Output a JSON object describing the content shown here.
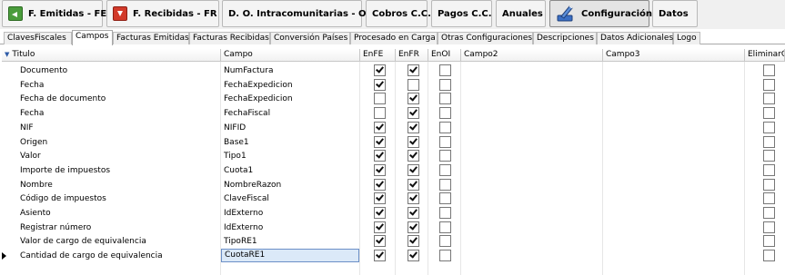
{
  "toolbar": {
    "buttons": [
      {
        "label": "F. Emitidas - FE",
        "icon": "invoice-issued-icon"
      },
      {
        "label": "F. Recibidas - FR",
        "icon": "invoice-received-icon"
      },
      {
        "label": "D. O. Intracomunitarias - OI"
      },
      {
        "label": "Cobros C.C."
      },
      {
        "label": "Pagos C.C."
      },
      {
        "label": "Anuales"
      },
      {
        "label": "Configuración",
        "icon": "configuration-icon",
        "active": true
      },
      {
        "label": "Datos"
      }
    ]
  },
  "tabs": [
    {
      "label": "ClavesFiscales"
    },
    {
      "label": "Campos",
      "active": true
    },
    {
      "label": "Facturas Emitidas"
    },
    {
      "label": "Facturas Recibidas"
    },
    {
      "label": "Conversión Países"
    },
    {
      "label": "Procesado en Carga"
    },
    {
      "label": "Otras Configuraciones"
    },
    {
      "label": "Descripciones"
    },
    {
      "label": "Datos Adicionales"
    },
    {
      "label": "Logo"
    }
  ],
  "grid": {
    "columns": [
      "Titulo",
      "Campo",
      "EnFE",
      "EnFR",
      "EnOI",
      "Campo2",
      "Campo3",
      "EliminarCe"
    ],
    "rows": [
      {
        "titulo": "Documento",
        "campo": "NumFactura",
        "enFE": true,
        "enFR": true,
        "enOI": false,
        "eliminar": false
      },
      {
        "titulo": "Fecha",
        "campo": "FechaExpedicion",
        "enFE": true,
        "enFR": false,
        "enOI": false,
        "eliminar": false
      },
      {
        "titulo": "Fecha de documento",
        "campo": "FechaExpedicion",
        "enFE": false,
        "enFR": true,
        "enOI": false,
        "eliminar": false
      },
      {
        "titulo": "Fecha",
        "campo": "FechaFiscal",
        "enFE": false,
        "enFR": true,
        "enOI": false,
        "eliminar": false
      },
      {
        "titulo": "NIF",
        "campo": "NIFID",
        "enFE": true,
        "enFR": true,
        "enOI": false,
        "eliminar": false
      },
      {
        "titulo": "Origen",
        "campo": "Base1",
        "enFE": true,
        "enFR": true,
        "enOI": false,
        "eliminar": false
      },
      {
        "titulo": "Valor",
        "campo": "Tipo1",
        "enFE": true,
        "enFR": true,
        "enOI": false,
        "eliminar": false
      },
      {
        "titulo": "Importe de impuestos",
        "campo": "Cuota1",
        "enFE": true,
        "enFR": true,
        "enOI": false,
        "eliminar": false
      },
      {
        "titulo": "Nombre",
        "campo": "NombreRazon",
        "enFE": true,
        "enFR": true,
        "enOI": false,
        "eliminar": false
      },
      {
        "titulo": "Código de impuestos",
        "campo": "ClaveFiscal",
        "enFE": true,
        "enFR": true,
        "enOI": false,
        "eliminar": false
      },
      {
        "titulo": "Asiento",
        "campo": "IdExterno",
        "enFE": true,
        "enFR": true,
        "enOI": false,
        "eliminar": false
      },
      {
        "titulo": "Registrar número",
        "campo": "IdExterno",
        "enFE": true,
        "enFR": true,
        "enOI": false,
        "eliminar": false
      },
      {
        "titulo": "Valor de cargo de equivalencia",
        "campo": "TipoRE1",
        "enFE": true,
        "enFR": true,
        "enOI": false,
        "eliminar": false
      },
      {
        "titulo": "Cantidad de cargo de equivalencia",
        "campo": "CuotaRE1",
        "enFE": true,
        "enFR": true,
        "enOI": false,
        "eliminar": false,
        "current": true
      }
    ]
  }
}
